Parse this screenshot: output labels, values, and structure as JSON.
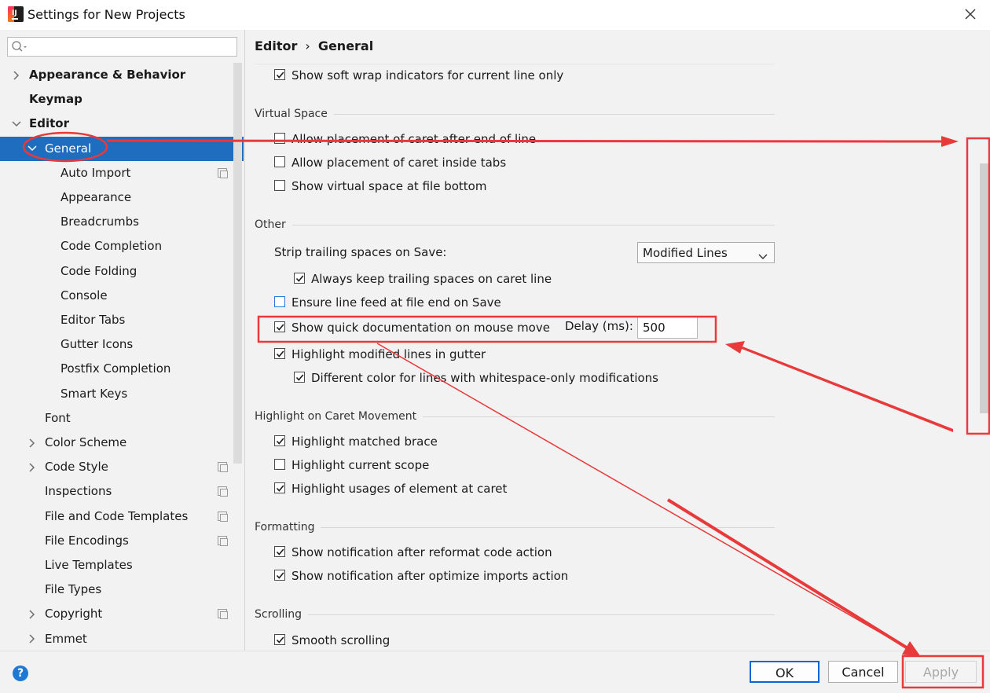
{
  "window": {
    "title": "Settings for New Projects"
  },
  "search": {
    "placeholder": ""
  },
  "tree": [
    {
      "label": "Appearance & Behavior",
      "level": 0,
      "bold": true,
      "expanded": false,
      "has_children": true
    },
    {
      "label": "Keymap",
      "level": 0,
      "bold": true,
      "has_children": false
    },
    {
      "label": "Editor",
      "level": 0,
      "bold": true,
      "expanded": true,
      "has_children": true
    },
    {
      "label": "General",
      "level": 1,
      "selected": true,
      "expanded": true,
      "has_children": true
    },
    {
      "label": "Auto Import",
      "level": 2,
      "project_icon": true
    },
    {
      "label": "Appearance",
      "level": 2
    },
    {
      "label": "Breadcrumbs",
      "level": 2
    },
    {
      "label": "Code Completion",
      "level": 2
    },
    {
      "label": "Code Folding",
      "level": 2
    },
    {
      "label": "Console",
      "level": 2
    },
    {
      "label": "Editor Tabs",
      "level": 2
    },
    {
      "label": "Gutter Icons",
      "level": 2
    },
    {
      "label": "Postfix Completion",
      "level": 2
    },
    {
      "label": "Smart Keys",
      "level": 2
    },
    {
      "label": "Font",
      "level": 1
    },
    {
      "label": "Color Scheme",
      "level": 1,
      "has_children": true,
      "expanded": false
    },
    {
      "label": "Code Style",
      "level": 1,
      "has_children": true,
      "expanded": false,
      "project_icon": true
    },
    {
      "label": "Inspections",
      "level": 1,
      "project_icon": true
    },
    {
      "label": "File and Code Templates",
      "level": 1,
      "project_icon": true
    },
    {
      "label": "File Encodings",
      "level": 1,
      "project_icon": true
    },
    {
      "label": "Live Templates",
      "level": 1
    },
    {
      "label": "File Types",
      "level": 1
    },
    {
      "label": "Copyright",
      "level": 1,
      "has_children": true,
      "expanded": false,
      "project_icon": true
    },
    {
      "label": "Emmet",
      "level": 1,
      "has_children": true,
      "expanded": false
    }
  ],
  "breadcrumb": {
    "parent": "Editor",
    "separator": "›",
    "current": "General"
  },
  "sections": {
    "virtual_space": "Virtual Space",
    "other": "Other",
    "highlight_caret": "Highlight on Caret Movement",
    "formatting": "Formatting",
    "scrolling": "Scrolling"
  },
  "options": {
    "soft_wrap_current_line": {
      "label": "Show soft wrap indicators for current line only",
      "checked": true
    },
    "caret_after_eol": {
      "label": "Allow placement of caret after end of line",
      "checked": false
    },
    "caret_inside_tabs": {
      "label": "Allow placement of caret inside tabs",
      "checked": false
    },
    "virtual_space_bottom": {
      "label": "Show virtual space at file bottom",
      "checked": false
    },
    "keep_trailing_spaces": {
      "label": "Always keep trailing spaces on caret line",
      "checked": true
    },
    "ensure_line_feed": {
      "label": "Ensure line feed at file end on Save",
      "checked": false
    },
    "quick_doc_mouse": {
      "label": "Show quick documentation on mouse move",
      "checked": true
    },
    "highlight_modified_lines": {
      "label": "Highlight modified lines in gutter",
      "checked": true
    },
    "whitespace_only_color": {
      "label": "Different color for lines with whitespace-only modifications",
      "checked": true
    },
    "highlight_matched_brace": {
      "label": "Highlight matched brace",
      "checked": true
    },
    "highlight_current_scope": {
      "label": "Highlight current scope",
      "checked": false
    },
    "highlight_usages": {
      "label": "Highlight usages of element at caret",
      "checked": true
    },
    "notify_reformat": {
      "label": "Show notification after reformat code action",
      "checked": true
    },
    "notify_optimize_imports": {
      "label": "Show notification after optimize imports action",
      "checked": true
    },
    "smooth_scrolling": {
      "label": "Smooth scrolling",
      "checked": true
    }
  },
  "strip_trailing": {
    "label": "Strip trailing spaces on Save:",
    "value": "Modified Lines"
  },
  "delay": {
    "label": "Delay (ms):",
    "value": "500"
  },
  "buttons": {
    "ok": "OK",
    "cancel": "Cancel",
    "apply": "Apply",
    "help": "?"
  },
  "annotation_color": "#e8393b",
  "selection_color": "#1f6dbf"
}
